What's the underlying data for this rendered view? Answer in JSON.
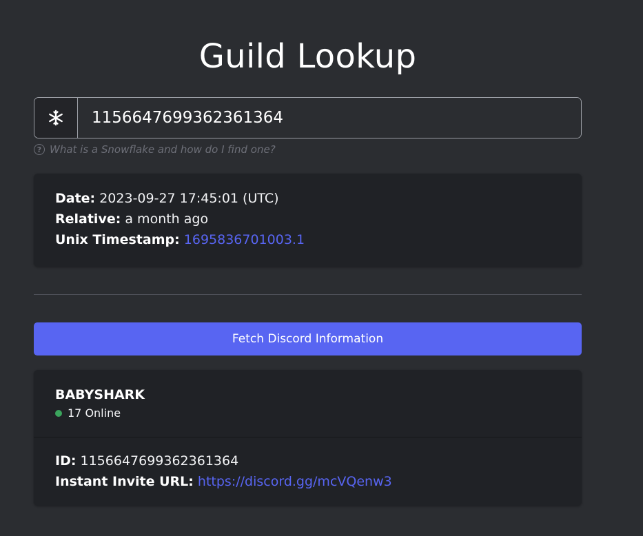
{
  "page": {
    "title": "Guild Lookup"
  },
  "search": {
    "icon": "snowflake-icon",
    "value": "1156647699362361364",
    "help_text": "What is a Snowflake and how do I find one?"
  },
  "snowflake_info": {
    "date_label": "Date:",
    "date_value": "2023-09-27 17:45:01 (UTC)",
    "relative_label": "Relative:",
    "relative_value": "a month ago",
    "unix_label": "Unix Timestamp:",
    "unix_value": "1695836701003.1"
  },
  "fetch_button": {
    "label": "Fetch Discord Information"
  },
  "guild": {
    "name": "BABYSHARK",
    "online": "17 Online",
    "online_color": "#3ba55d",
    "id_label": "ID:",
    "id_value": "1156647699362361364",
    "invite_label": "Instant Invite URL:",
    "invite_value": "https://discord.gg/mcVQenw3"
  },
  "colors": {
    "background": "#2b2d31",
    "card": "#202226",
    "accent": "#5865f2"
  }
}
